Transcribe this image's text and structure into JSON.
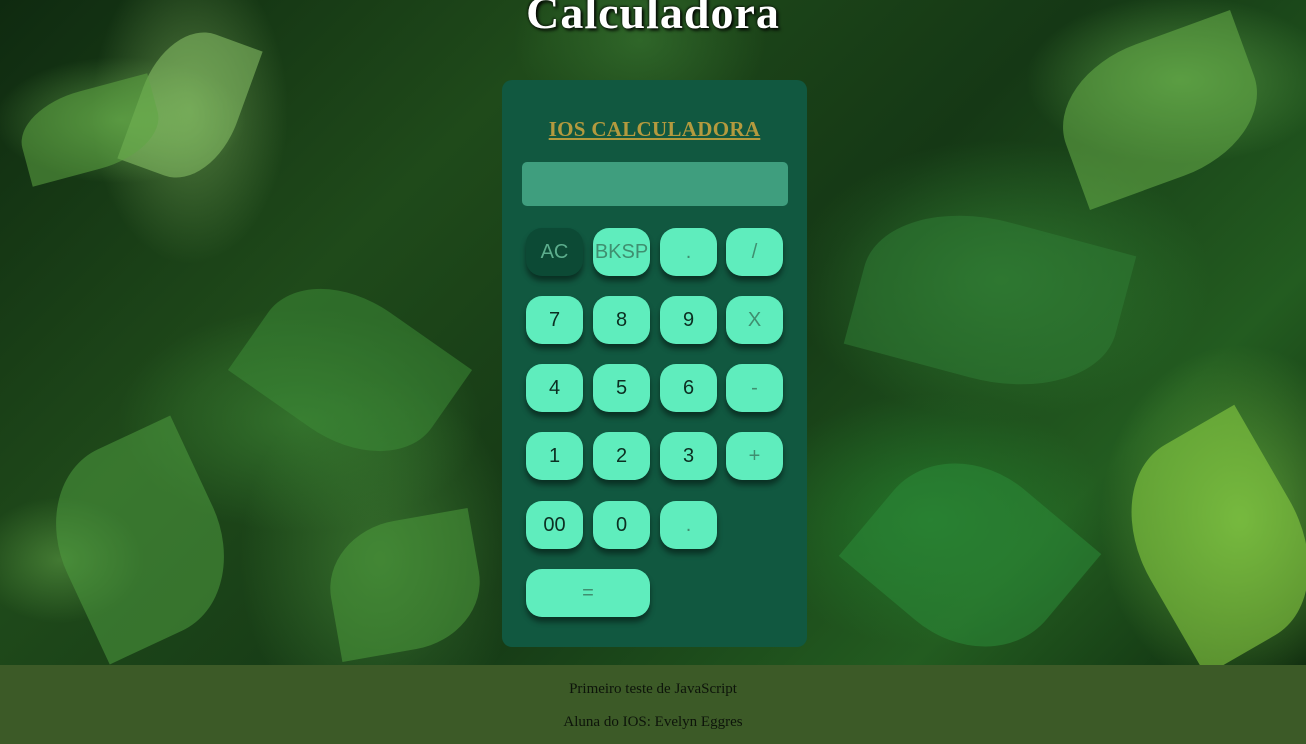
{
  "page": {
    "title": "Calculadora"
  },
  "calculator": {
    "heading": "IOS CALCULADORA",
    "display_value": "",
    "rows": [
      [
        {
          "label": "AC",
          "name": "clear-button",
          "style": "dark"
        },
        {
          "label": "BKSP",
          "name": "backspace-button",
          "style": "op"
        },
        {
          "label": ".",
          "name": "dot-button-top",
          "style": "op"
        },
        {
          "label": "/",
          "name": "divide-button",
          "style": "op"
        }
      ],
      [
        {
          "label": "7",
          "name": "digit-7-button",
          "style": "num"
        },
        {
          "label": "8",
          "name": "digit-8-button",
          "style": "num"
        },
        {
          "label": "9",
          "name": "digit-9-button",
          "style": "num"
        },
        {
          "label": "X",
          "name": "multiply-button",
          "style": "op"
        }
      ],
      [
        {
          "label": "4",
          "name": "digit-4-button",
          "style": "num"
        },
        {
          "label": "5",
          "name": "digit-5-button",
          "style": "num"
        },
        {
          "label": "6",
          "name": "digit-6-button",
          "style": "num"
        },
        {
          "label": "-",
          "name": "subtract-button",
          "style": "op"
        }
      ],
      [
        {
          "label": "1",
          "name": "digit-1-button",
          "style": "num"
        },
        {
          "label": "2",
          "name": "digit-2-button",
          "style": "num"
        },
        {
          "label": "3",
          "name": "digit-3-button",
          "style": "num"
        },
        {
          "label": "+",
          "name": "add-button",
          "style": "op"
        }
      ],
      [
        {
          "label": "00",
          "name": "double-zero-button",
          "style": "num"
        },
        {
          "label": "0",
          "name": "digit-0-button",
          "style": "num"
        },
        {
          "label": ".",
          "name": "decimal-button",
          "style": "op"
        }
      ],
      [
        {
          "label": "=",
          "name": "equals-button",
          "style": "wide"
        }
      ]
    ]
  },
  "footer": {
    "line1": "Primeiro teste de JavaScript",
    "line2": "Aluna do IOS: Evelyn Eggres"
  },
  "colors": {
    "panel": "#115840",
    "button": "#5fedbd",
    "button_dark": "#0c4a35",
    "display": "#3f9e7e",
    "heading": "#b49a3e",
    "footer": "#3c5a27"
  }
}
